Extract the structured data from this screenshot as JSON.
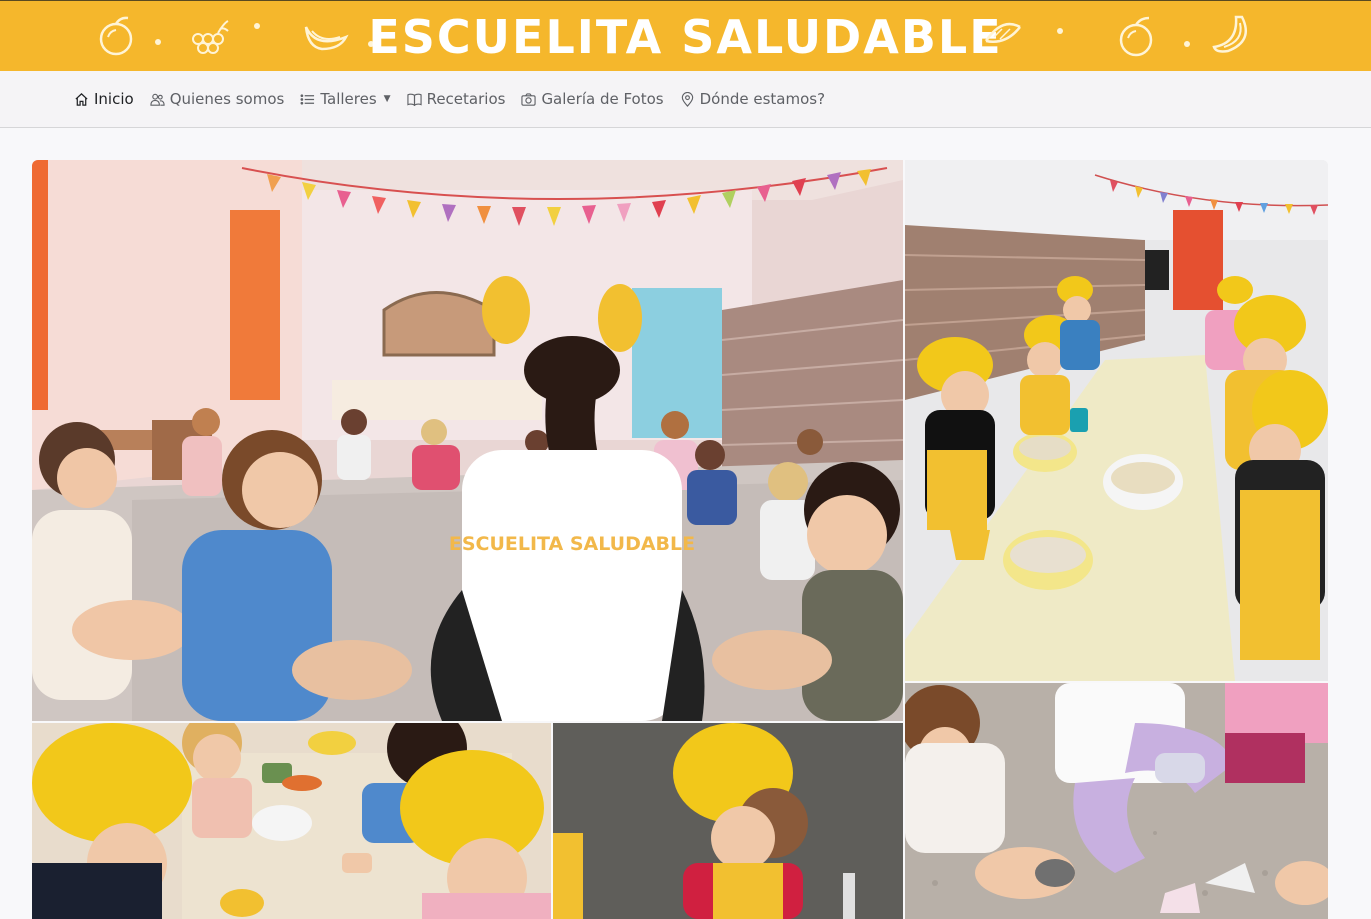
{
  "site": {
    "title": "ESCUELITA SALUDABLE",
    "brand_color": "#f5b72c"
  },
  "nav": {
    "items": [
      {
        "label": "Inicio",
        "icon": "home-icon",
        "active": true
      },
      {
        "label": "Quienes somos",
        "icon": "people-icon",
        "active": false
      },
      {
        "label": "Talleres",
        "icon": "list-icon",
        "active": false,
        "dropdown": true
      },
      {
        "label": "Recetarios",
        "icon": "book-icon",
        "active": false
      },
      {
        "label": "Galería de Fotos",
        "icon": "camera-icon",
        "active": false
      },
      {
        "label": "Dónde estamos?",
        "icon": "map-pin-icon",
        "active": false
      }
    ]
  },
  "gallery": {
    "photos": [
      {
        "name": "photo-group-circle",
        "alt": "Niños sentados en ronda"
      },
      {
        "name": "photo-cooking-table",
        "alt": "Niños cocinando con gorros amarillos"
      },
      {
        "name": "photo-floor-activity",
        "alt": "Niños jugando en el piso"
      },
      {
        "name": "photo-mixing-bowl",
        "alt": "Niños mezclando en un bol"
      },
      {
        "name": "photo-chef-hat-girl",
        "alt": "Niña con gorro de chef"
      }
    ],
    "shirt_text": "ESCUELITA SALUDABLE"
  }
}
